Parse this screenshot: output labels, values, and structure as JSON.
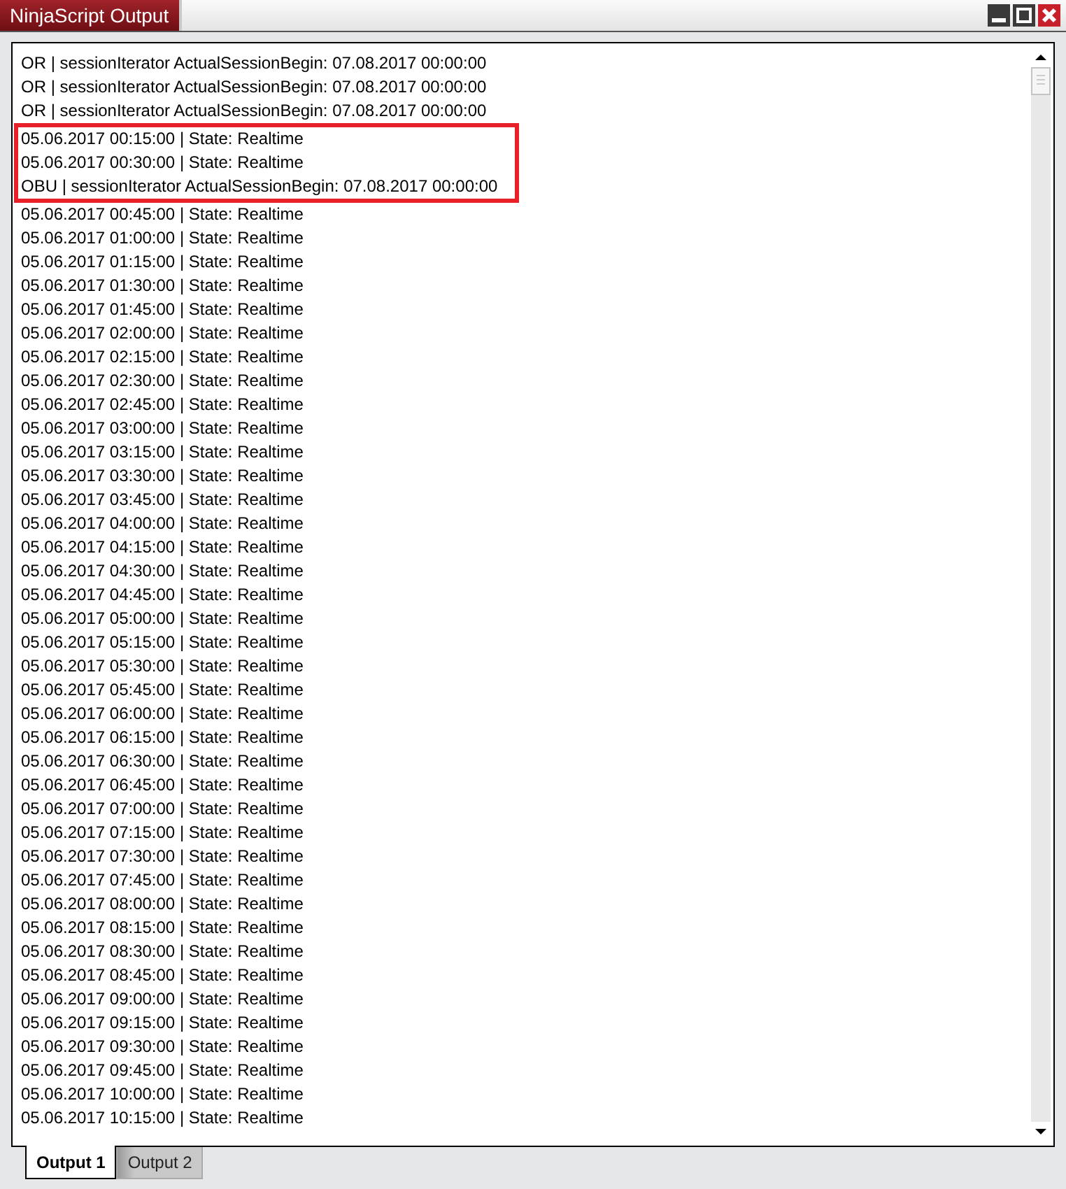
{
  "window": {
    "title": "NinjaScript Output"
  },
  "lines": [
    {
      "text": "OR | sessionIterator ActualSessionBegin: 07.08.2017 00:00:00",
      "highlighted": false
    },
    {
      "text": "OR | sessionIterator ActualSessionBegin: 07.08.2017 00:00:00",
      "highlighted": false
    },
    {
      "text": "OR | sessionIterator ActualSessionBegin: 07.08.2017 00:00:00",
      "highlighted": false
    },
    {
      "text": "05.06.2017 00:15:00 | State: Realtime",
      "highlighted": true
    },
    {
      "text": "05.06.2017 00:30:00 | State: Realtime",
      "highlighted": true
    },
    {
      "text": "OBU | sessionIterator ActualSessionBegin: 07.08.2017 00:00:00",
      "highlighted": true
    },
    {
      "text": "05.06.2017 00:45:00 | State: Realtime",
      "highlighted": false
    },
    {
      "text": "05.06.2017 01:00:00 | State: Realtime",
      "highlighted": false
    },
    {
      "text": "05.06.2017 01:15:00 | State: Realtime",
      "highlighted": false
    },
    {
      "text": "05.06.2017 01:30:00 | State: Realtime",
      "highlighted": false
    },
    {
      "text": "05.06.2017 01:45:00 | State: Realtime",
      "highlighted": false
    },
    {
      "text": "05.06.2017 02:00:00 | State: Realtime",
      "highlighted": false
    },
    {
      "text": "05.06.2017 02:15:00 | State: Realtime",
      "highlighted": false
    },
    {
      "text": "05.06.2017 02:30:00 | State: Realtime",
      "highlighted": false
    },
    {
      "text": "05.06.2017 02:45:00 | State: Realtime",
      "highlighted": false
    },
    {
      "text": "05.06.2017 03:00:00 | State: Realtime",
      "highlighted": false
    },
    {
      "text": "05.06.2017 03:15:00 | State: Realtime",
      "highlighted": false
    },
    {
      "text": "05.06.2017 03:30:00 | State: Realtime",
      "highlighted": false
    },
    {
      "text": "05.06.2017 03:45:00 | State: Realtime",
      "highlighted": false
    },
    {
      "text": "05.06.2017 04:00:00 | State: Realtime",
      "highlighted": false
    },
    {
      "text": "05.06.2017 04:15:00 | State: Realtime",
      "highlighted": false
    },
    {
      "text": "05.06.2017 04:30:00 | State: Realtime",
      "highlighted": false
    },
    {
      "text": "05.06.2017 04:45:00 | State: Realtime",
      "highlighted": false
    },
    {
      "text": "05.06.2017 05:00:00 | State: Realtime",
      "highlighted": false
    },
    {
      "text": "05.06.2017 05:15:00 | State: Realtime",
      "highlighted": false
    },
    {
      "text": "05.06.2017 05:30:00 | State: Realtime",
      "highlighted": false
    },
    {
      "text": "05.06.2017 05:45:00 | State: Realtime",
      "highlighted": false
    },
    {
      "text": "05.06.2017 06:00:00 | State: Realtime",
      "highlighted": false
    },
    {
      "text": "05.06.2017 06:15:00 | State: Realtime",
      "highlighted": false
    },
    {
      "text": "05.06.2017 06:30:00 | State: Realtime",
      "highlighted": false
    },
    {
      "text": "05.06.2017 06:45:00 | State: Realtime",
      "highlighted": false
    },
    {
      "text": "05.06.2017 07:00:00 | State: Realtime",
      "highlighted": false
    },
    {
      "text": "05.06.2017 07:15:00 | State: Realtime",
      "highlighted": false
    },
    {
      "text": "05.06.2017 07:30:00 | State: Realtime",
      "highlighted": false
    },
    {
      "text": "05.06.2017 07:45:00 | State: Realtime",
      "highlighted": false
    },
    {
      "text": "05.06.2017 08:00:00 | State: Realtime",
      "highlighted": false
    },
    {
      "text": "05.06.2017 08:15:00 | State: Realtime",
      "highlighted": false
    },
    {
      "text": "05.06.2017 08:30:00 | State: Realtime",
      "highlighted": false
    },
    {
      "text": "05.06.2017 08:45:00 | State: Realtime",
      "highlighted": false
    },
    {
      "text": "05.06.2017 09:00:00 | State: Realtime",
      "highlighted": false
    },
    {
      "text": "05.06.2017 09:15:00 | State: Realtime",
      "highlighted": false
    },
    {
      "text": "05.06.2017 09:30:00 | State: Realtime",
      "highlighted": false
    },
    {
      "text": "05.06.2017 09:45:00 | State: Realtime",
      "highlighted": false
    },
    {
      "text": "05.06.2017 10:00:00 | State: Realtime",
      "highlighted": false
    },
    {
      "text": "05.06.2017 10:15:00 | State: Realtime",
      "highlighted": false
    }
  ],
  "tabs": [
    {
      "label": "Output 1",
      "selected": true
    },
    {
      "label": "Output 2",
      "selected": false
    }
  ]
}
